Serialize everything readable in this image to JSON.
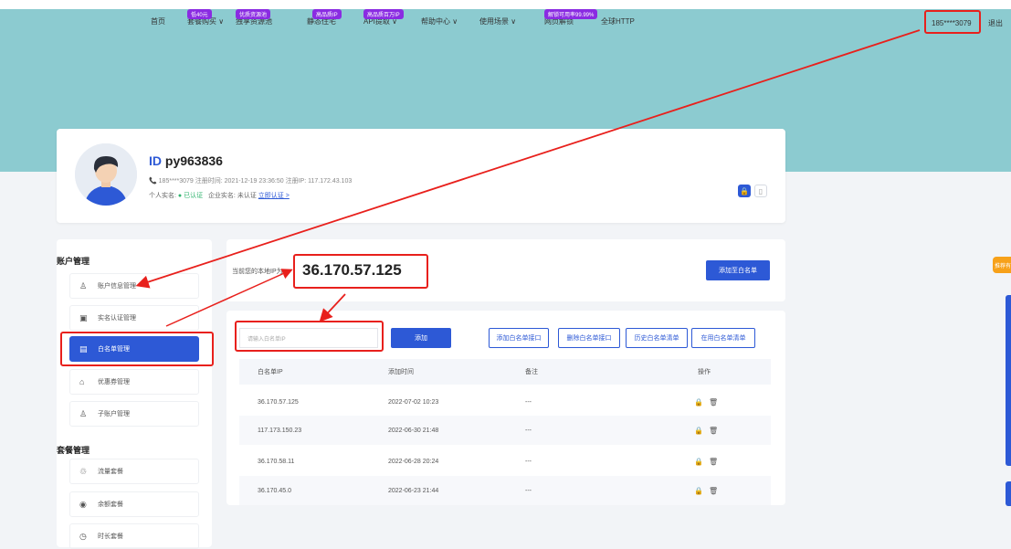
{
  "nav": {
    "items": [
      {
        "label": "首页",
        "badge": ""
      },
      {
        "label": "套餐购买 ∨",
        "badge": "低40元"
      },
      {
        "label": "独享资源池",
        "badge": "优质资源池"
      },
      {
        "label": "静态住宅",
        "badge": "高品质IP"
      },
      {
        "label": "API提取 ∨",
        "badge": "高品质百万IP"
      },
      {
        "label": "帮助中心 ∨",
        "badge": ""
      },
      {
        "label": "使用场景 ∨",
        "badge": ""
      },
      {
        "label": "网页解锁",
        "badge": "解锁可用率99.99%"
      },
      {
        "label": "全球HTTP",
        "badge": ""
      }
    ],
    "user_phone": "185****3079",
    "logout": "退出"
  },
  "profile": {
    "id_label": "ID",
    "id_value": "py963836",
    "meta": "📞 185****3079  注册时间: 2021-12-19 23:36:50  注册IP: 117.172.43.103",
    "personal_label": "个人实名:",
    "personal_status": "已认证",
    "company_label": "企业实名: 未认证",
    "company_link": "立即认证 >"
  },
  "sidebar": {
    "account_title": "账户管理",
    "account_items": [
      {
        "label": "账户信息管理",
        "icon": "user-icon"
      },
      {
        "label": "实名认证管理",
        "icon": "id-card-icon"
      },
      {
        "label": "白名单管理",
        "icon": "whitelist-icon"
      },
      {
        "label": "优惠券管理",
        "icon": "coupon-icon"
      },
      {
        "label": "子账户管理",
        "icon": "sub-account-icon"
      }
    ],
    "package_title": "套餐管理",
    "package_items": [
      {
        "label": "流量套餐",
        "icon": "traffic-icon"
      },
      {
        "label": "余额套餐",
        "icon": "balance-icon"
      },
      {
        "label": "时长套餐",
        "icon": "clock-icon"
      }
    ]
  },
  "ip_card": {
    "label": "当前您的本地IP为:",
    "ip": "36.170.57.125",
    "add_button": "添加至白名单"
  },
  "whitelist": {
    "input_placeholder": "请输入白名单IP",
    "add_button": "添加",
    "actions": [
      "添加白名单接口",
      "删除白名单接口",
      "历史白名单清单",
      "在用白名单清单"
    ],
    "columns": [
      "白名单IP",
      "添加时间",
      "备注",
      "操作"
    ],
    "rows": [
      {
        "ip": "36.170.57.125",
        "time": "2022-07-02 10:23",
        "note": "---",
        "ops": "🔒🗑"
      },
      {
        "ip": "117.173.150.23",
        "time": "2022-06-30 21:48",
        "note": "---",
        "ops": "🔒🗑"
      },
      {
        "ip": "36.170.58.11",
        "time": "2022-06-28 20:24",
        "note": "---",
        "ops": "🔒🗑"
      },
      {
        "ip": "36.170.45.0",
        "time": "2022-06-23 21:44",
        "note": "---",
        "ops": "🔒🗑"
      }
    ]
  },
  "side_tab": "推荐有礼",
  "colors": {
    "primary": "#2d59d6",
    "hero": "#8ccbd0",
    "highlight": "#e8201c",
    "success": "#2fb36d"
  }
}
